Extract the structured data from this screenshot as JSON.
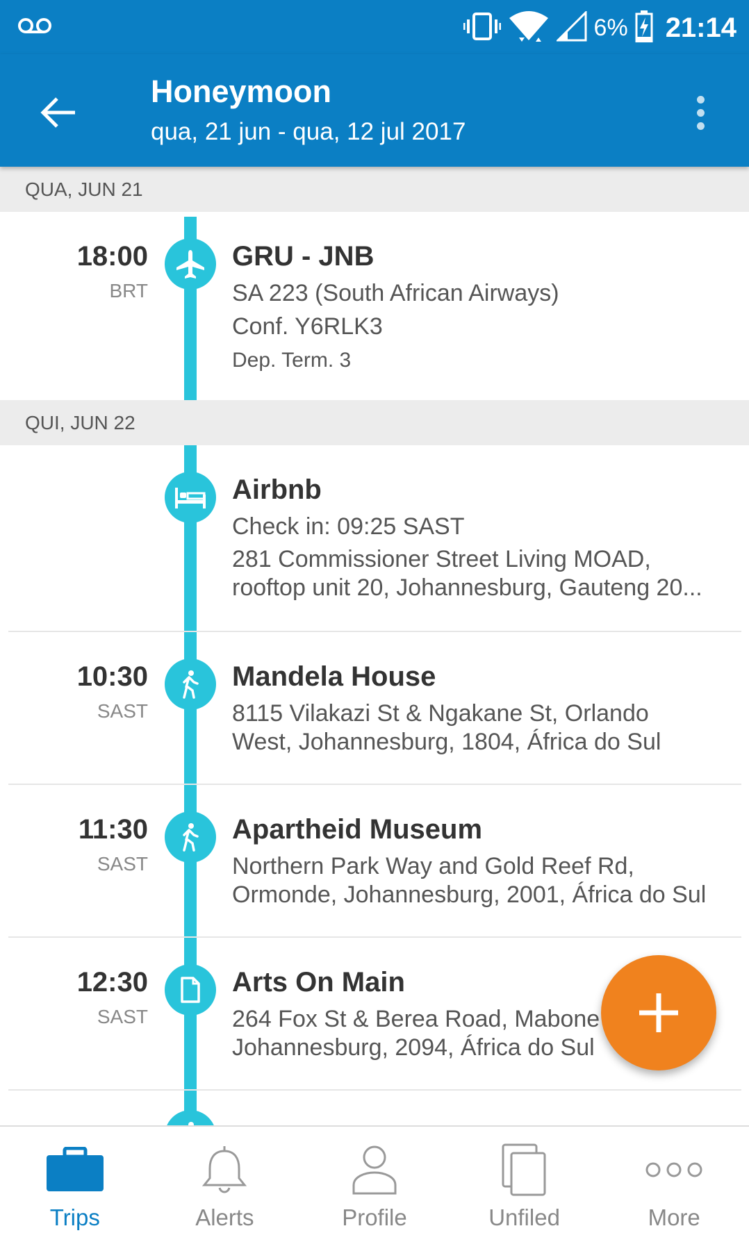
{
  "status_bar": {
    "battery": "6%",
    "time": "21:14"
  },
  "header": {
    "title": "Honeymoon",
    "subtitle": "qua, 21 jun - qua, 12 jul 2017"
  },
  "days": [
    {
      "label": "QUA, JUN 21",
      "items": [
        {
          "icon": "airplane-icon",
          "time": "18:00",
          "tz": "BRT",
          "title": "GRU - JNB",
          "lines": [
            "SA 223 (South African Airways)",
            "Conf. Y6RLK3",
            "Dep. Term. 3"
          ]
        }
      ]
    },
    {
      "label": "QUI, JUN 22",
      "items": [
        {
          "icon": "bed-icon",
          "time": "",
          "tz": "",
          "title": "Airbnb",
          "lines": [
            "Check in: 09:25 SAST",
            "281 Commissioner Street Living MOAD,",
            "rooftop unit 20, Johannesburg, Gauteng 20..."
          ]
        },
        {
          "icon": "walking-icon",
          "time": "10:30",
          "tz": "SAST",
          "title": "Mandela House",
          "lines": [
            "8115 Vilakazi St & Ngakane St, Orlando",
            "West, Johannesburg, 1804, África do Sul"
          ]
        },
        {
          "icon": "walking-icon",
          "time": "11:30",
          "tz": "SAST",
          "title": "Apartheid Museum",
          "lines": [
            "Northern Park Way and Gold Reef Rd,",
            "Ormonde, Johannesburg, 2001, África do Sul"
          ]
        },
        {
          "icon": "document-icon",
          "time": "12:30",
          "tz": "SAST",
          "title": "Arts On Main",
          "lines": [
            "264 Fox St & Berea Road, Mabone",
            "Johannesburg, 2094, África do Sul"
          ]
        }
      ]
    }
  ],
  "fab": {
    "icon": "plus-icon"
  },
  "bottom_nav": [
    {
      "label": "Trips",
      "icon": "briefcase-icon",
      "active": true
    },
    {
      "label": "Alerts",
      "icon": "bell-icon",
      "active": false
    },
    {
      "label": "Profile",
      "icon": "person-icon",
      "active": false
    },
    {
      "label": "Unfiled",
      "icon": "documents-icon",
      "active": false
    },
    {
      "label": "More",
      "icon": "more-dots-icon",
      "active": false
    }
  ],
  "colors": {
    "primary": "#0b7fc4",
    "timeline": "#29c4db",
    "fab": "#f0821e",
    "day_header_bg": "#ececec"
  }
}
